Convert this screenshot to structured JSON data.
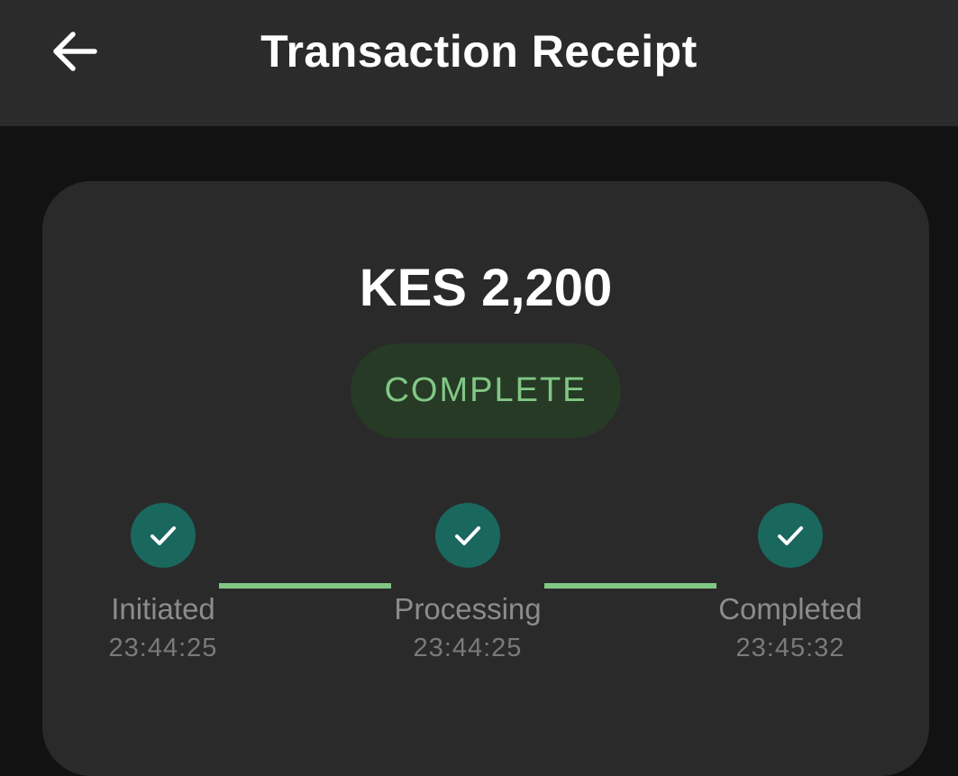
{
  "app_bar": {
    "title": "Transaction Receipt",
    "back_icon": "arrow-back-icon"
  },
  "receipt": {
    "amount": "KES 2,200",
    "status": "COMPLETE"
  },
  "steps": [
    {
      "label": "Initiated",
      "time": "23:44:25",
      "icon": "check-icon"
    },
    {
      "label": "Processing",
      "time": "23:44:25",
      "icon": "check-icon"
    },
    {
      "label": "Completed",
      "time": "23:45:32",
      "icon": "check-icon"
    }
  ],
  "colors": {
    "background": "#121212",
    "app_bar": "#2b2b2b",
    "card": "#2a2a2a",
    "status_text": "#81c784",
    "status_bg": "#263a26",
    "step_circle": "#1a675e",
    "connector": "#81c784"
  }
}
